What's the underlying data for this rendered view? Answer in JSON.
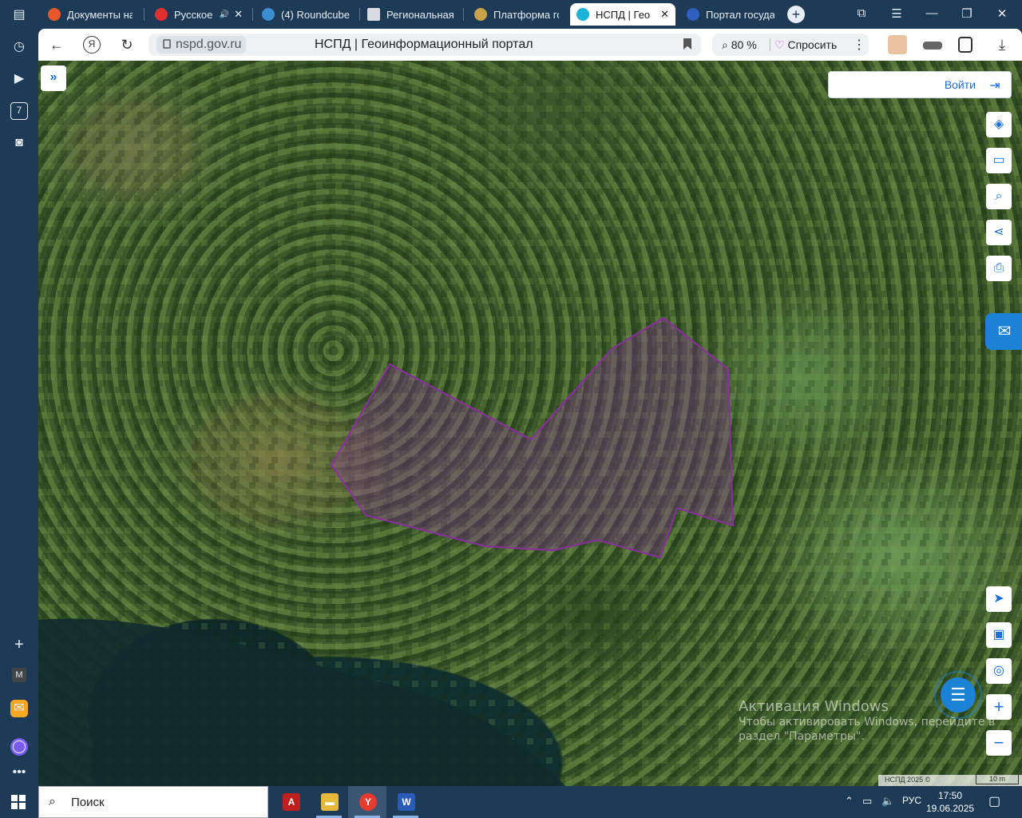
{
  "browser": {
    "tabs": [
      {
        "label": "Документы на",
        "color": "#e8572a"
      },
      {
        "label": "Русское",
        "color": "#e03030",
        "audio": "🔊",
        "close": "✕"
      },
      {
        "label": "(4) Roundcube",
        "color": "#3b8fd0"
      },
      {
        "label": "Региональная",
        "color": "#d8dce0"
      },
      {
        "label": "Платформа го",
        "color": "#c9a24a"
      },
      {
        "label": "НСПД | Гео",
        "color": "#1bb3d6",
        "close": "✕"
      },
      {
        "label": "Портал госуда",
        "color": "#3060c0"
      }
    ],
    "new_tab": "+",
    "address": {
      "domain": "nspd.gov.ru",
      "page_title": "НСПД | Геоинформационный портал"
    },
    "zoom": "80 %",
    "ask": "Спросить"
  },
  "map": {
    "login": "Войти",
    "watermark": {
      "line1": "Активация Windows",
      "line2": "Чтобы активировать Windows, перейдите в",
      "line3": "раздел \"Параметры\"."
    },
    "attribution": "НСПД 2025 ©",
    "scale": "10 m",
    "parcel_color": "#8b2fa0"
  },
  "taskbar": {
    "search": "Поиск",
    "lang": "РУС",
    "time": "17:50",
    "date": "19.06.2025"
  }
}
